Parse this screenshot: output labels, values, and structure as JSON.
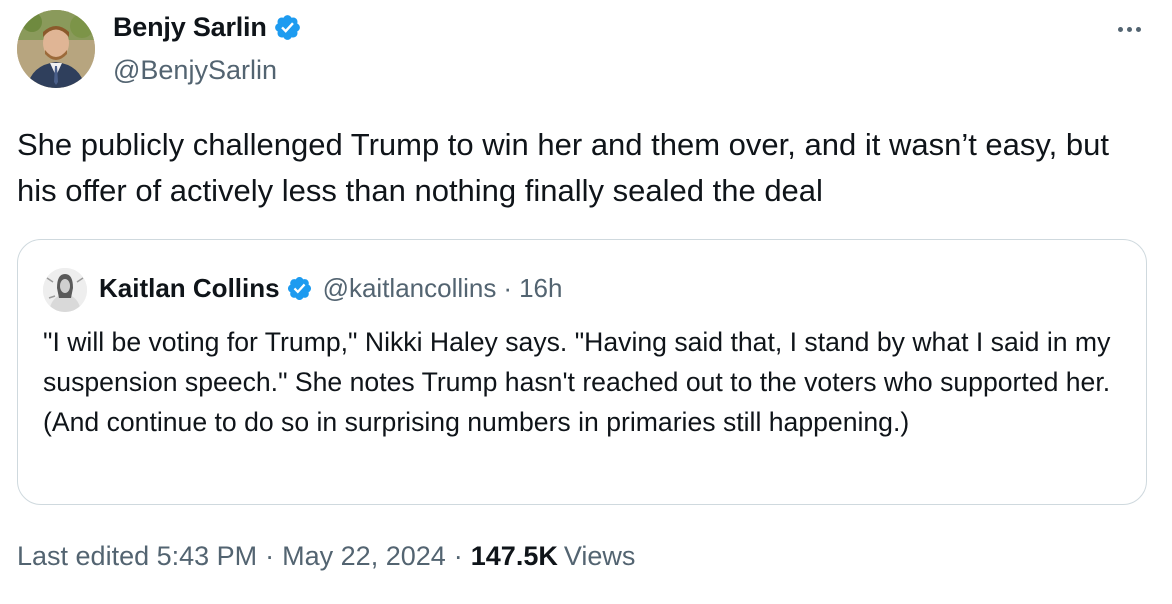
{
  "author": {
    "name": "Benjy Sarlin",
    "handle": "@BenjySarlin",
    "verified": true
  },
  "tweet": {
    "text": "She publicly challenged Trump to win her and them over, and it wasn’t easy, but his offer of actively less than nothing finally sealed the deal"
  },
  "quoted_tweet": {
    "name": "Kaitlan Collins",
    "handle": "@kaitlancollins",
    "separator": "·",
    "time": "16h",
    "verified": true,
    "text": "\"I will be voting for Trump,\" Nikki Haley says. \"Having said that, I stand by what I said in my suspension speech.\" She notes Trump hasn't reached out to the voters who supported her. (And continue to do so in surprising numbers in primaries still happening.)"
  },
  "meta": {
    "edited_label": "Last edited 5:43 PM",
    "separator": "·",
    "date": "May 22, 2024",
    "views_count": "147.5K",
    "views_label": "Views"
  },
  "icons": {
    "verified": "verified-badge-icon",
    "more": "more-options-icon"
  },
  "colors": {
    "verified_blue": "#1d9bf0",
    "text_primary": "#0f1419",
    "text_secondary": "#536471",
    "border": "#cfd9de"
  }
}
